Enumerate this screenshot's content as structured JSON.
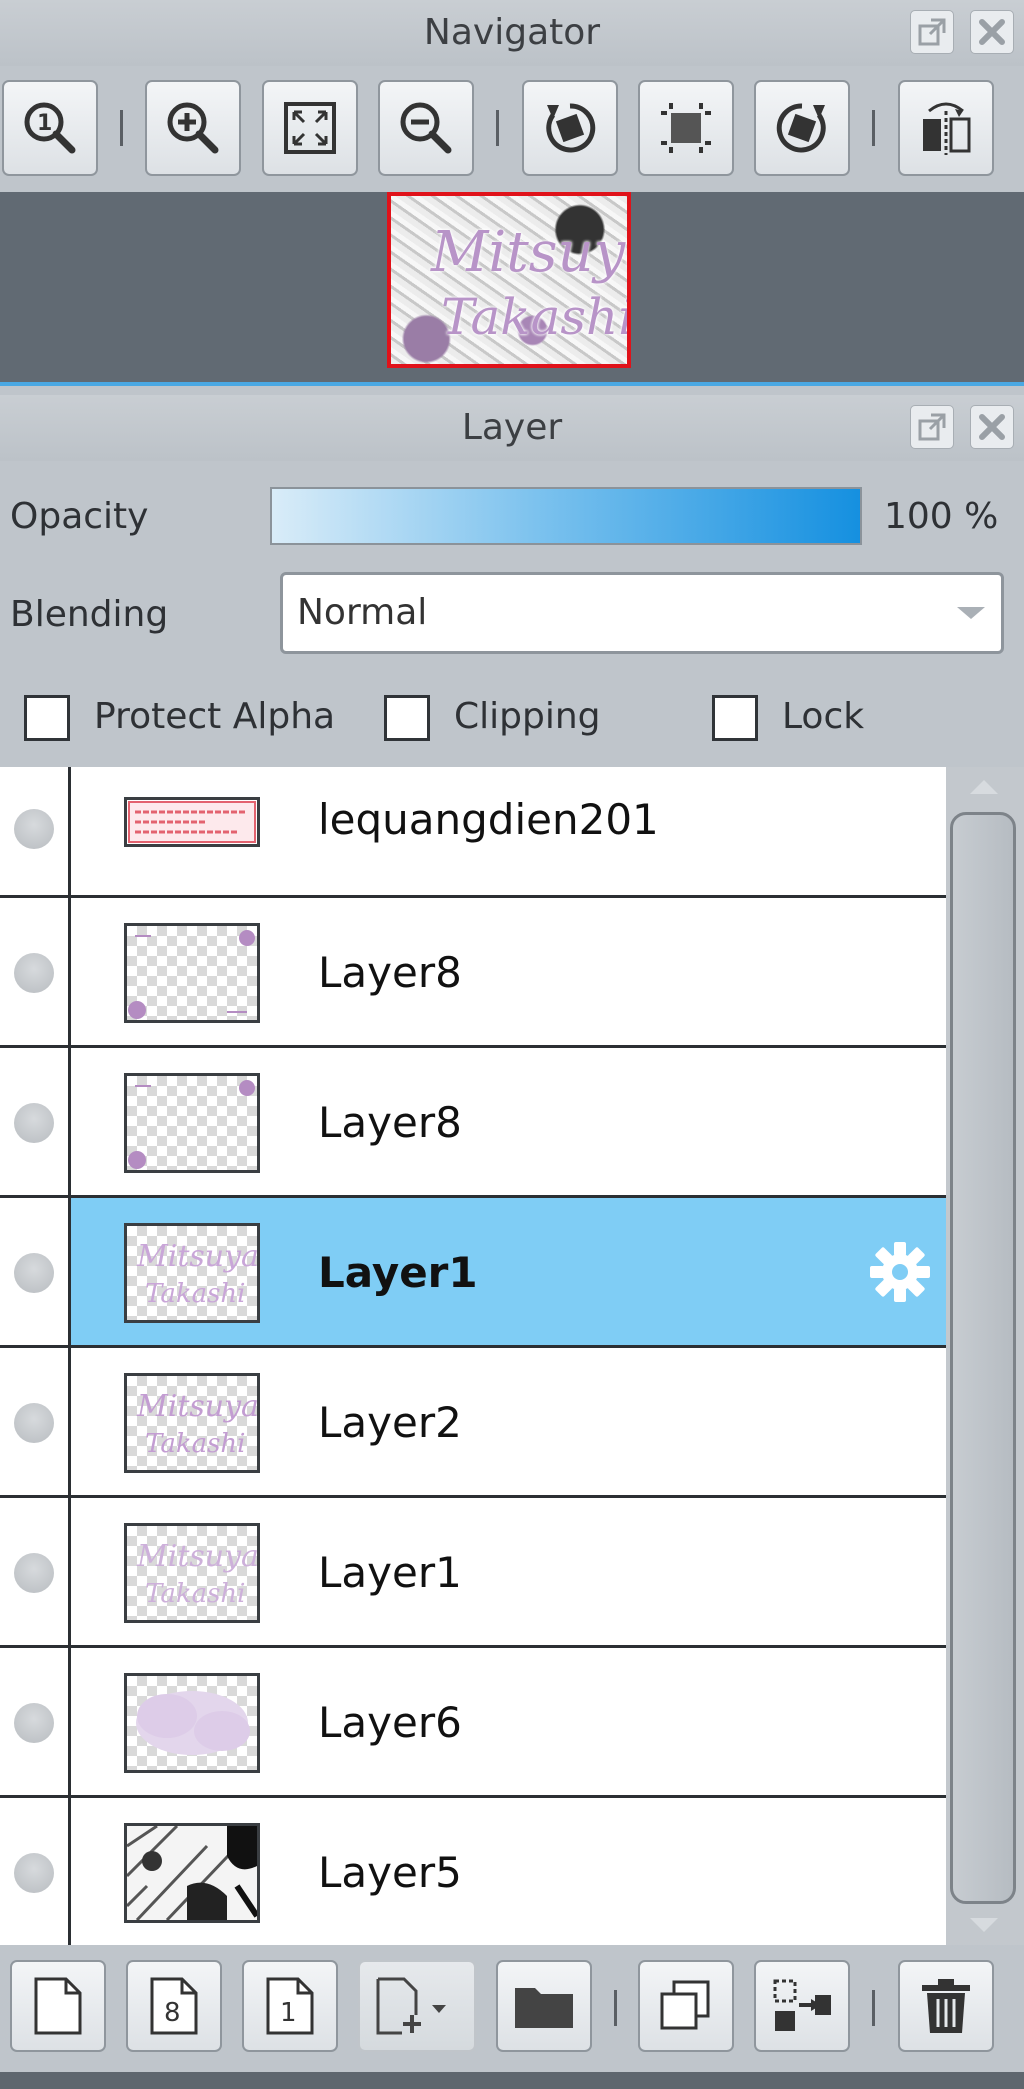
{
  "navigator": {
    "title": "Navigator",
    "tools": [
      "zoom-100-icon",
      "zoom-in-icon",
      "fit-to-window-icon",
      "zoom-out-icon",
      "rotate-left-icon",
      "reset-rotation-icon",
      "rotate-right-icon",
      "flip-horizontal-icon"
    ],
    "thumbnail_text_line1": "Mitsuya",
    "thumbnail_text_line2": "Takashi"
  },
  "layer_panel": {
    "title": "Layer",
    "opacity_label": "Opacity",
    "opacity_value": 100,
    "opacity_text": "100 %",
    "blending_label": "Blending",
    "blending_value": "Normal",
    "checkboxes": {
      "protect_alpha": "Protect Alpha",
      "clipping": "Clipping",
      "lock": "Lock"
    },
    "layers": [
      {
        "name": "lequangdien201",
        "selected": false
      },
      {
        "name": "Layer8",
        "selected": false
      },
      {
        "name": "Layer8",
        "selected": false
      },
      {
        "name": "Layer1",
        "selected": true
      },
      {
        "name": "Layer2",
        "selected": false
      },
      {
        "name": "Layer1",
        "selected": false
      },
      {
        "name": "Layer6",
        "selected": false
      },
      {
        "name": "Layer5",
        "selected": false
      }
    ]
  },
  "bottom_toolbar": [
    "new-layer-icon",
    "new-8bit-layer-icon",
    "new-1bit-layer-icon",
    "add-layer-dropdown-icon",
    "new-folder-icon",
    "duplicate-layer-icon",
    "merge-down-icon",
    "delete-layer-icon"
  ],
  "colors": {
    "selected_row": "#7fcdf5",
    "accent_divider": "#4aa8e3",
    "navigator_frame": "#e0121a"
  }
}
